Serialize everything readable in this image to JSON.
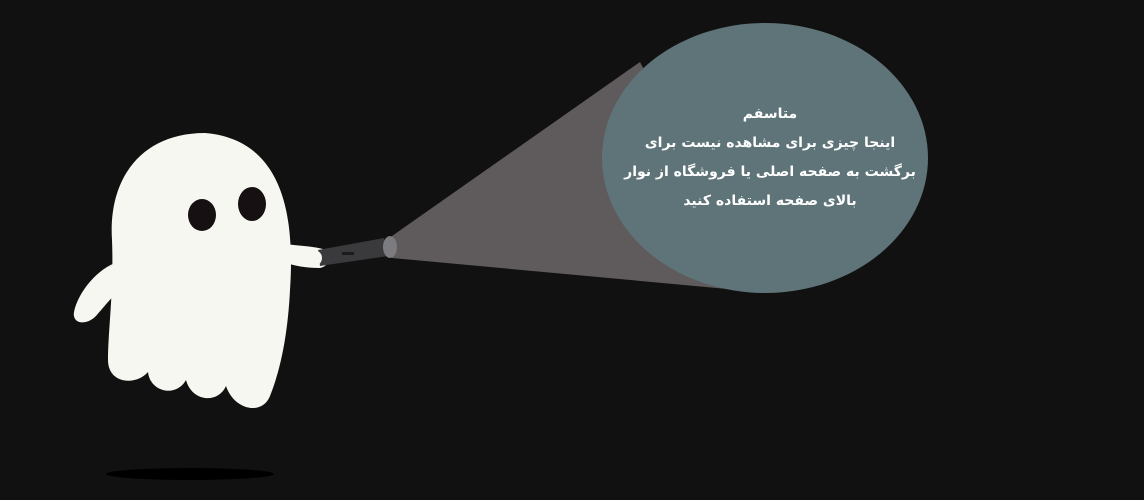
{
  "message": {
    "title": "متاسفم",
    "lines": [
      "اینجا چیزی برای مشاهده نیست برای",
      "برگشت به صفحه اصلی یا فروشگاه از نوار",
      "بالای صفحه استفاده کنید"
    ]
  },
  "icons": {
    "character": "ghost-icon",
    "tool": "flashlight-icon"
  },
  "colors": {
    "background": "#111111",
    "ghost": "#f7f7f1",
    "light_beam": "#5f5a5b",
    "spot": "#5e7479",
    "text": "#ffffff"
  }
}
